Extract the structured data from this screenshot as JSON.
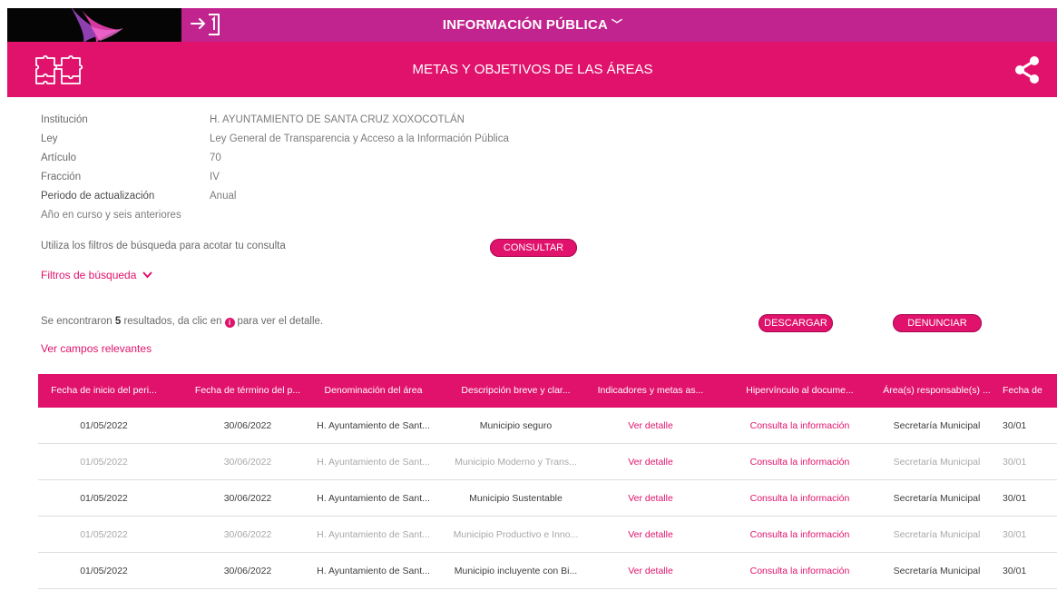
{
  "header": {
    "top_title": "INFORMACIÓN PÚBLICA",
    "section_title": "METAS Y OBJETIVOS DE LAS ÁREAS",
    "brand_color": "#c2248f",
    "accent_color": "#e0126c"
  },
  "info": {
    "institucion_label": "Institución",
    "institucion_value": "H. AYUNTAMIENTO DE SANTA CRUZ XOXOCOTLÁN",
    "ley_label": "Ley",
    "ley_value": "Ley General de Transparencia y Acceso a la Información Pública",
    "articulo_label": "Artículo",
    "articulo_value": "70",
    "fraccion_label": "Fracción",
    "fraccion_value": "IV",
    "periodo_label": "Periodo de actualización",
    "periodo_value": "Anual",
    "anio_text": "Año en curso y seis anteriores"
  },
  "search": {
    "hint": "Utiliza los filtros de búsqueda para acotar tu consulta",
    "consultar_label": "CONSULTAR",
    "filters_label": "Filtros de búsqueda"
  },
  "results": {
    "prefix": "Se encontraron",
    "count": "5",
    "middle": "resultados, da clic en",
    "suffix": "para ver el detalle.",
    "descargar_label": "DESCARGAR",
    "denunciar_label": "DENUNCIAR",
    "ver_campos_label": "Ver campos relevantes"
  },
  "table": {
    "columns": [
      "Fecha de inicio del peri...",
      "Fecha de término del p...",
      "Denominación del área",
      "Descripción breve y clar...",
      "Indicadores y metas as...",
      "Hipervínculo al docume...",
      "Área(s) responsable(s) ...",
      "Fecha de"
    ],
    "rows": [
      [
        "01/05/2022",
        "30/06/2022",
        "H. Ayuntamiento de Sant...",
        "Municipio seguro",
        "Ver detalle",
        "Consulta la información",
        "Secretaría Municipal",
        "30/01"
      ],
      [
        "01/05/2022",
        "30/06/2022",
        "H. Ayuntamiento de Sant...",
        "Municipio Moderno y Trans...",
        "Ver detalle",
        "Consulta la información",
        "Secretaría Municipal",
        "30/01"
      ],
      [
        "01/05/2022",
        "30/06/2022",
        "H. Ayuntamiento de Sant...",
        "Municipio Sustentable",
        "Ver detalle",
        "Consulta la información",
        "Secretaría Municipal",
        "30/01"
      ],
      [
        "01/05/2022",
        "30/06/2022",
        "H. Ayuntamiento de Sant...",
        "Municipio Productivo e Inno...",
        "Ver detalle",
        "Consulta la información",
        "Secretaría Municipal",
        "30/01"
      ],
      [
        "01/05/2022",
        "30/06/2022",
        "H. Ayuntamiento de Sant...",
        "Municipio incluyente con Bi...",
        "Ver detalle",
        "Consulta la información",
        "Secretaría Municipal",
        "30/01"
      ]
    ]
  }
}
